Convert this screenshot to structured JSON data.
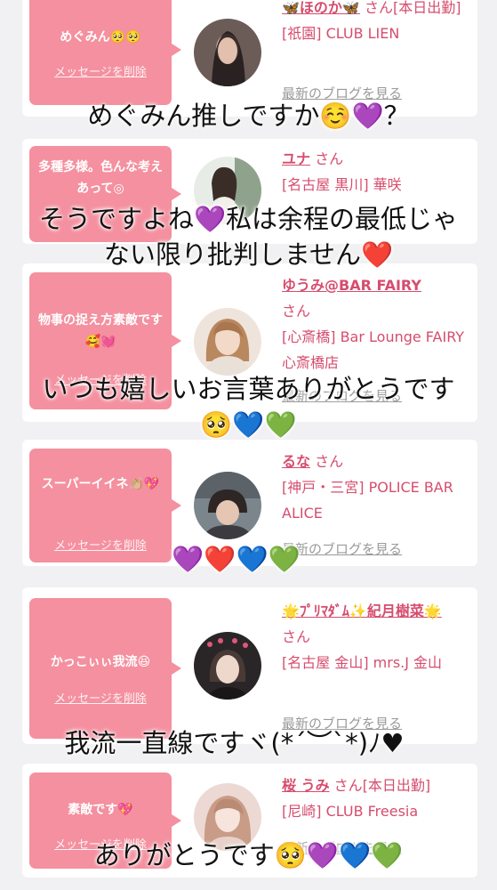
{
  "cards": [
    {
      "message": "めぐみん🥺🥺",
      "delete_label": "メッセージを削除",
      "name": "🦋ほのか🦋",
      "honorific": "さん",
      "status": "[本日出勤]",
      "location": "[祇園] CLUB LIEN",
      "blog_label": "最新のブログを見る"
    },
    {
      "message": "多種多様。色んな考えあって◎",
      "delete_label": "",
      "name": "ユナ",
      "honorific": "さん",
      "status": "",
      "location": "[名古屋 黒川] 華咲",
      "blog_label": ""
    },
    {
      "message": "物事の捉え方素敵です🥰💓",
      "delete_label": "メッセージを削除",
      "name": "ゆうみ@BAR FAIRY",
      "honorific": "さん",
      "status": "",
      "location": "[心斎橋] Bar Lounge FAIRY 心斎橋店",
      "blog_label": "最新のブログを見る"
    },
    {
      "message": "スーパーイイネ👏🏼💖",
      "delete_label": "メッセージを削除",
      "name": "るな",
      "honorific": "さん",
      "status": "",
      "location": "[神戸・三宮] POLICE BAR ALICE",
      "blog_label": "最新のブログを見る"
    },
    {
      "message": "かっこぃぃ我流😆",
      "delete_label": "メッセージを削除",
      "name": "🌟ﾌﾟﾘﾏﾀﾞﾑ✨紀月樹菜🌟",
      "honorific": "さん",
      "status": "",
      "location": "[名古屋 金山] mrs.J 金山",
      "blog_label": "最新のブログを見る"
    },
    {
      "message": "素敵です💖",
      "delete_label": "メッセージを削除",
      "name": "桜 うみ",
      "honorific": "さん",
      "status": "[本日出勤]",
      "location": "[尼崎] CLUB Freesia",
      "blog_label": "最新のブログを見る"
    }
  ],
  "overlay_captions": [
    "めぐみん推しですか☺️💜？",
    "そうですよね💜私は余程の最低じゃ",
    "ない限り批判しません❤️",
    "いつも嬉しいお言葉ありがとうです",
    "🥺💙💚",
    "💜❤️💙💚",
    "我流一直線ですヾ(*´︶`*)ﾉ♥",
    "ありがとうです🥺💜💙💚"
  ],
  "colors": {
    "bubble": "#f4909f",
    "accent_text": "#d64d6e",
    "link_text": "#9a9a9a",
    "background": "#f1f0f2"
  }
}
